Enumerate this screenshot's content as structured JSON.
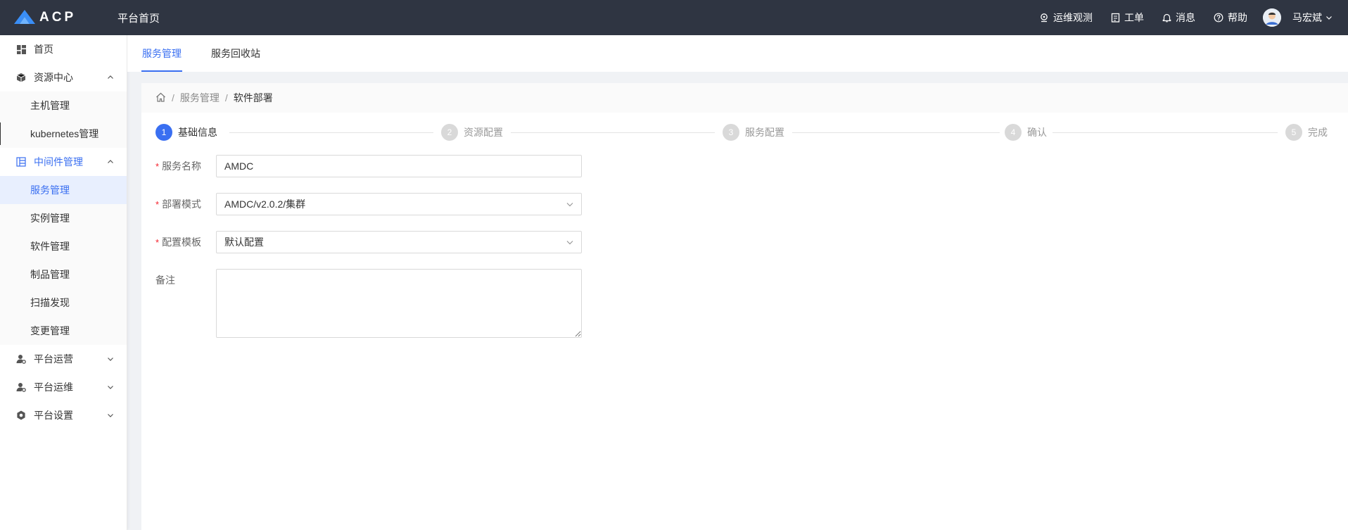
{
  "app": {
    "logo_text": "ACP",
    "platform_home": "平台首页"
  },
  "topnav": {
    "links": [
      {
        "label": "运维观测",
        "icon": "observe-icon"
      },
      {
        "label": "工单",
        "icon": "ticket-icon"
      },
      {
        "label": "消息",
        "icon": "bell-icon"
      },
      {
        "label": "帮助",
        "icon": "help-icon"
      }
    ],
    "username": "马宏斌"
  },
  "sidebar": {
    "items": [
      {
        "label": "首页",
        "icon": "dashboard-icon"
      },
      {
        "label": "资源中心",
        "icon": "cube-icon",
        "expanded": true,
        "children": [
          {
            "label": "主机管理"
          },
          {
            "label": "kubernetes管理"
          }
        ]
      },
      {
        "label": "中间件管理",
        "icon": "middleware-icon",
        "expanded": true,
        "active": true,
        "children": [
          {
            "label": "服务管理",
            "active": true
          },
          {
            "label": "实例管理"
          },
          {
            "label": "软件管理"
          },
          {
            "label": "制品管理"
          },
          {
            "label": "扫描发现"
          },
          {
            "label": "变更管理"
          }
        ]
      },
      {
        "label": "平台运营",
        "icon": "user-gear-icon",
        "expanded": false
      },
      {
        "label": "平台运维",
        "icon": "user-gear-icon",
        "expanded": false
      },
      {
        "label": "平台设置",
        "icon": "settings-icon",
        "expanded": false
      }
    ]
  },
  "tabs": [
    {
      "label": "服务管理",
      "active": true
    },
    {
      "label": "服务回收站",
      "active": false
    }
  ],
  "breadcrumb": {
    "items": [
      "服务管理",
      "软件部署"
    ]
  },
  "steps": [
    {
      "num": "1",
      "label": "基础信息",
      "current": true
    },
    {
      "num": "2",
      "label": "资源配置"
    },
    {
      "num": "3",
      "label": "服务配置"
    },
    {
      "num": "4",
      "label": "确认"
    },
    {
      "num": "5",
      "label": "完成"
    }
  ],
  "form": {
    "service_name": {
      "label": "服务名称",
      "value": "AMDC",
      "required": true
    },
    "deploy_mode": {
      "label": "部署模式",
      "value": "AMDC/v2.0.2/集群",
      "required": true
    },
    "config_template": {
      "label": "配置模板",
      "value": "默认配置",
      "required": true
    },
    "remark": {
      "label": "备注",
      "value": ""
    }
  },
  "colors": {
    "accent": "#3a6ff1",
    "topbar": "#2f3542",
    "required": "#f5222d"
  }
}
